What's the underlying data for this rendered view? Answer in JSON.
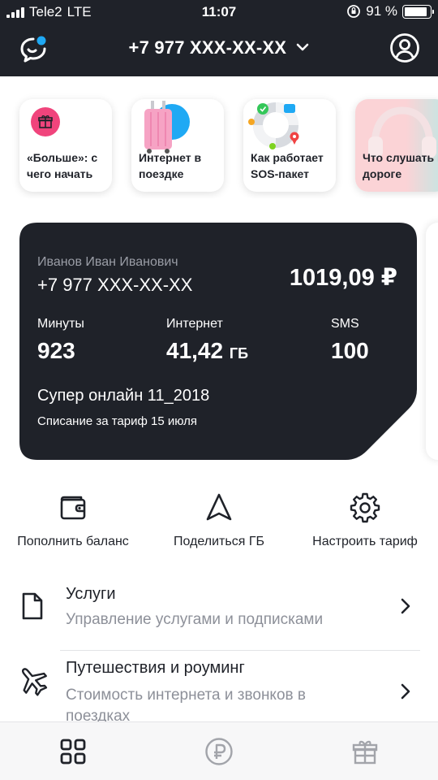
{
  "status_bar": {
    "carrier": "Tele2",
    "network": "LTE",
    "time": "11:07",
    "battery_text": "91 %",
    "battery_level": 0.91
  },
  "header": {
    "phone_number": "+7 977 XXX-XX-XX",
    "support_icon": "chat-bubble-icon",
    "profile_icon": "user-circle-icon"
  },
  "stories": [
    {
      "title": "«Больше»: с чего начать",
      "icon": "gift-icon"
    },
    {
      "title": "Интернет в поездке",
      "icon": "suitcase-icon"
    },
    {
      "title": "Как работает SOS-пакет",
      "icon": "lifebuoy-icon"
    },
    {
      "title": "Что слушать в дороге",
      "icon": "headphones-icon"
    }
  ],
  "account_card": {
    "owner": "Иванов Иван Иванович",
    "phone": "+7 977 XXX-XX-XX",
    "balance": "1019,09 ₽",
    "minutes_label": "Минуты",
    "minutes_value": "923",
    "internet_label": "Интернет",
    "internet_value": "41,42",
    "internet_unit": "ГБ",
    "sms_label": "SMS",
    "sms_value": "100",
    "tariff_name": "Супер онлайн 11_2018",
    "charge_text": "Списание за тариф 15 июля"
  },
  "actions": [
    {
      "label": "Пополнить баланс",
      "icon": "wallet-icon"
    },
    {
      "label": "Поделиться ГБ",
      "icon": "navigation-arrow-icon"
    },
    {
      "label": "Настроить тариф",
      "icon": "gear-icon"
    }
  ],
  "menu": [
    {
      "title": "Услуги",
      "subtitle": "Управление услугами и подписками",
      "icon": "document-icon"
    },
    {
      "title": "Путешествия и роуминг",
      "subtitle": "Стоимость интернета и звонков в поездках",
      "icon": "airplane-icon"
    }
  ],
  "tabbar": [
    {
      "icon": "grid-icon",
      "active": true
    },
    {
      "icon": "ruble-icon",
      "active": false
    },
    {
      "icon": "gift-icon",
      "active": false
    }
  ],
  "colors": {
    "header_bg": "#1f2229",
    "card_bg": "#1f2229",
    "accent_pink": "#f0447c",
    "accent_blue": "#1fa9f4",
    "muted_text": "#8d9099"
  }
}
